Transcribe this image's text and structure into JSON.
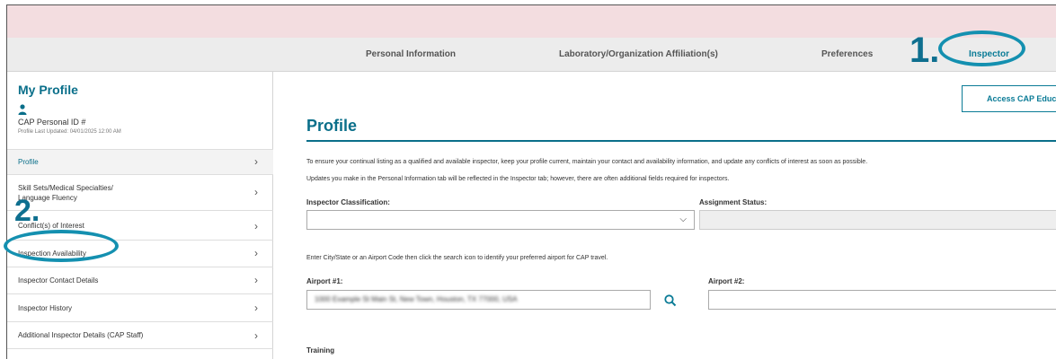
{
  "tabs": [
    {
      "label": "Personal Information",
      "active": false
    },
    {
      "label": "Laboratory/Organization Affiliation(s)",
      "active": false
    },
    {
      "label": "Preferences",
      "active": false
    },
    {
      "label": "Inspector",
      "active": true
    }
  ],
  "sidebar": {
    "title": "My Profile",
    "personal_id_label": "CAP Personal ID #",
    "last_updated": "Profile Last Updated: 04/01/2025 12:00 AM",
    "items": [
      {
        "label": "Profile",
        "active": true
      },
      {
        "label": "Skill Sets/Medical Specialties/\nLanguage Fluency",
        "active": false
      },
      {
        "label": "Conflict(s) of Interest",
        "active": false
      },
      {
        "label": "Inspection Availability",
        "active": false
      },
      {
        "label": "Inspector Contact Details",
        "active": false
      },
      {
        "label": "Inspector History",
        "active": false
      },
      {
        "label": "Additional Inspector Details (CAP Staff)",
        "active": false
      }
    ]
  },
  "main": {
    "access_button_label": "Access CAP Education",
    "page_title": "Profile",
    "paragraph1": "To ensure your continual listing as a qualified and available inspector, keep your profile current, maintain your contact and availability information, and update any conflicts of interest as soon as possible.",
    "paragraph2": "Updates you make in the Personal Information tab will be reflected in the Inspector tab; however, there are often additional fields required for inspectors.",
    "classification_label": "Inspector Classification:",
    "classification_value": "",
    "assignment_status_label": "Assignment Status:",
    "assignment_status_value": "",
    "airport_hint": "Enter City/State or an Airport Code then click the search icon to identify your preferred airport for CAP travel.",
    "airport1_label": "Airport #1:",
    "airport1_value": "1000 Example St Main St, New Town, Houston, TX 77000, USA",
    "airport2_label": "Airport #2:",
    "airport2_value": "",
    "training_label": "Training"
  },
  "annotations": {
    "step1": "1.",
    "step2": "2."
  },
  "colors": {
    "accent": "#0a6f8a",
    "banner": "#f3dde0",
    "annotation": "#1490b0"
  }
}
